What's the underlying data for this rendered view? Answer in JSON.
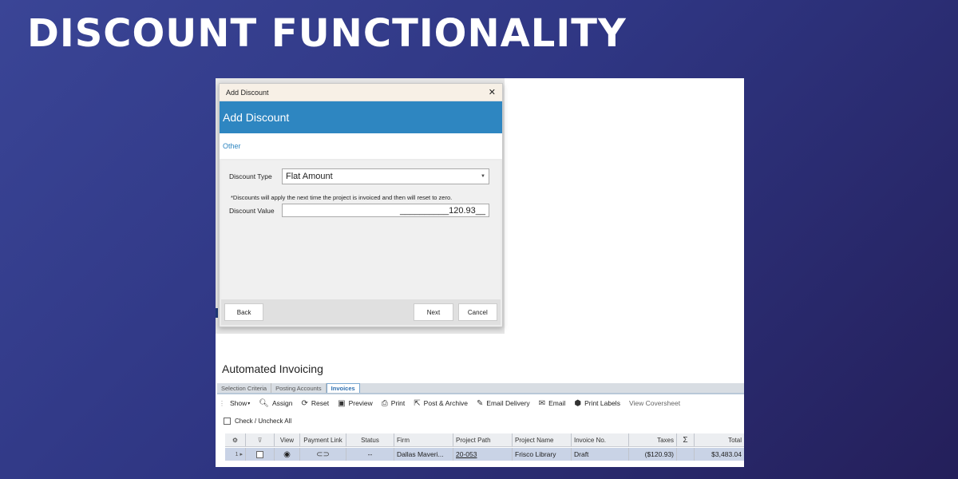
{
  "slide_title": "DISCOUNT FUNCTIONALITY",
  "dialog": {
    "window_title": "Add Discount",
    "header": "Add Discount",
    "tab": "Other",
    "discount_type_label": "Discount Type",
    "discount_type_value": "Flat Amount",
    "note": "*Discounts will apply the next time the project is invoiced and then will reset to zero.",
    "discount_value_label": "Discount Value",
    "discount_value": "__________120.93__",
    "back_label": "Back",
    "next_label": "Next",
    "cancel_label": "Cancel"
  },
  "invoicing": {
    "title": "Automated Invoicing",
    "tabs": [
      "Selection Criteria",
      "Posting Accounts",
      "Invoices"
    ],
    "toolbar": {
      "show": "Show",
      "assign": "Assign",
      "reset": "Reset",
      "preview": "Preview",
      "print": "Print",
      "post_archive": "Post & Archive",
      "email_delivery": "Email Delivery",
      "email": "Email",
      "print_labels": "Print Labels",
      "view_coversheet": "View Coversheet"
    },
    "check_all": "Check / Uncheck All",
    "columns": {
      "view": "View",
      "payment_link": "Payment Link",
      "status": "Status",
      "firm": "Firm",
      "project_path": "Project Path",
      "project_name": "Project Name",
      "invoice_no": "Invoice No.",
      "taxes": "Taxes",
      "sigma": "Σ",
      "total": "Total"
    },
    "row": {
      "index": "1",
      "status": "--",
      "firm": "Dallas Maveri...",
      "project_path": "20-053",
      "project_name": "Frisco Library",
      "invoice_no": "Draft",
      "taxes": "($120.93)",
      "total": "$3,483.04"
    }
  }
}
